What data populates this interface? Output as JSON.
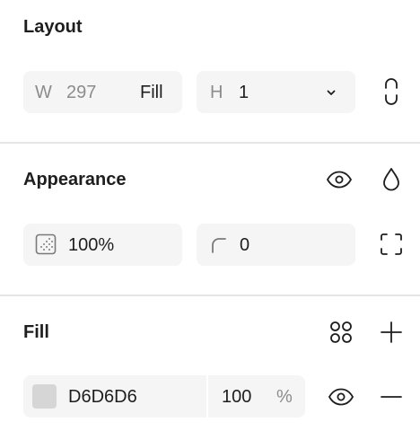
{
  "layout": {
    "title": "Layout",
    "width": {
      "label": "W",
      "value": "297",
      "mode": "Fill"
    },
    "height": {
      "label": "H",
      "value": "1"
    }
  },
  "appearance": {
    "title": "Appearance",
    "opacity": "100%",
    "corner_radius": "0"
  },
  "fill": {
    "title": "Fill",
    "items": [
      {
        "color": "#D6D6D6",
        "hex": "D6D6D6",
        "opacity": "100",
        "unit": "%"
      }
    ]
  },
  "icons": {
    "dimension_lock": "link-vertical-icon",
    "height_dropdown": "chevron-down-icon",
    "visibility": "eye-icon",
    "blend": "drop-icon",
    "opacity": "opacity-grid-icon",
    "radius": "corner-radius-icon",
    "corners": "expand-corners-icon",
    "styles": "four-dots-icon",
    "add": "plus-icon",
    "remove": "minus-icon"
  }
}
